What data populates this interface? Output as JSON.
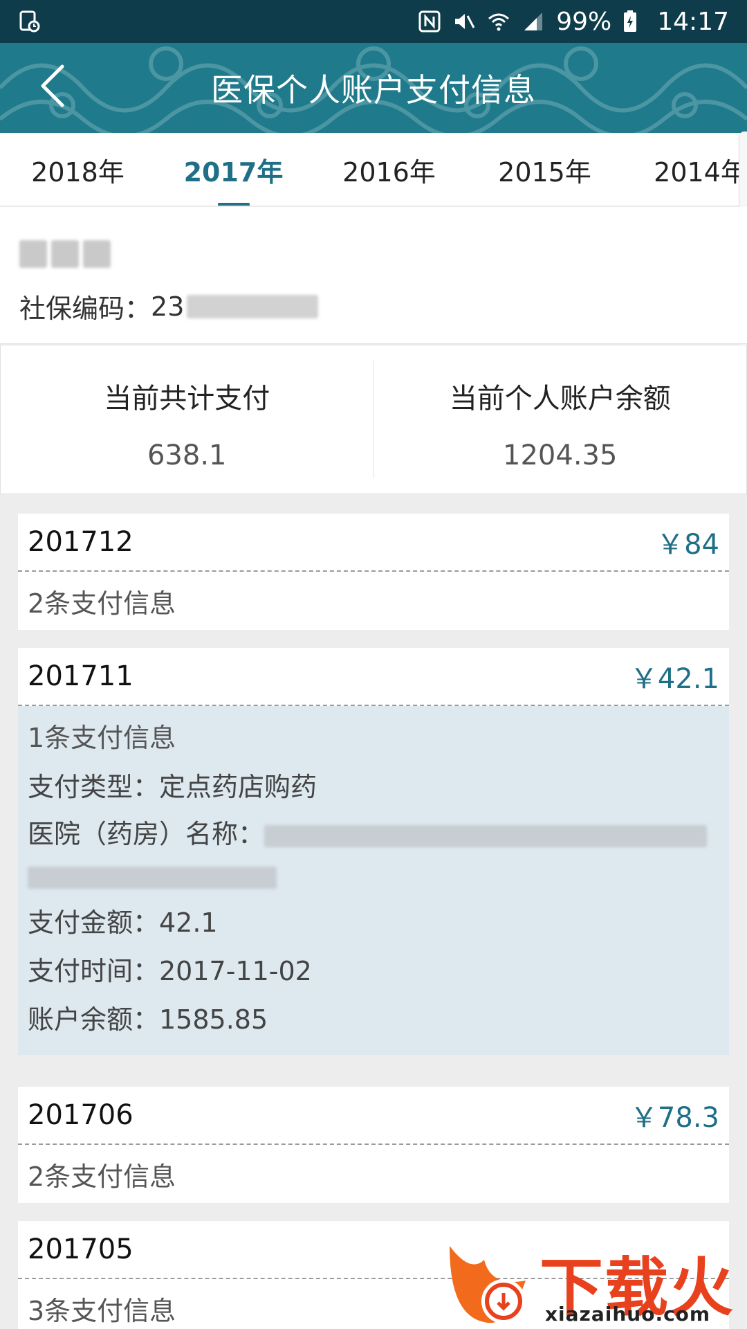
{
  "status_bar": {
    "battery": "99%",
    "time": "14:17"
  },
  "header": {
    "title": "医保个人账户支付信息"
  },
  "tabs": [
    {
      "label": "2018年"
    },
    {
      "label": "2017年"
    },
    {
      "label": "2016年"
    },
    {
      "label": "2015年"
    },
    {
      "label": "2014年"
    }
  ],
  "user": {
    "ssn_label": "社保编码：",
    "ssn_visible": "23"
  },
  "summary": {
    "total_label": "当前共计支付",
    "total_value": "638.1",
    "balance_label": "当前个人账户余额",
    "balance_value": "1204.35"
  },
  "months": [
    {
      "month": "201712",
      "amount": "￥84",
      "count": "2条支付信息"
    },
    {
      "month": "201711",
      "amount": "￥42.1",
      "count": "1条支付信息",
      "details": {
        "type": "支付类型：定点药店购药",
        "hospital_label": "医院（药房）名称：",
        "pay_amount": "支付金额：42.1",
        "pay_time": "支付时间：2017-11-02",
        "balance": "账户余额：1585.85"
      }
    },
    {
      "month": "201706",
      "amount": "￥78.3",
      "count": "2条支付信息"
    },
    {
      "month": "201705",
      "amount": "",
      "count": "3条支付信息"
    }
  ],
  "watermark": {
    "brand": "下载火",
    "url": "xiazaihuo.com"
  }
}
